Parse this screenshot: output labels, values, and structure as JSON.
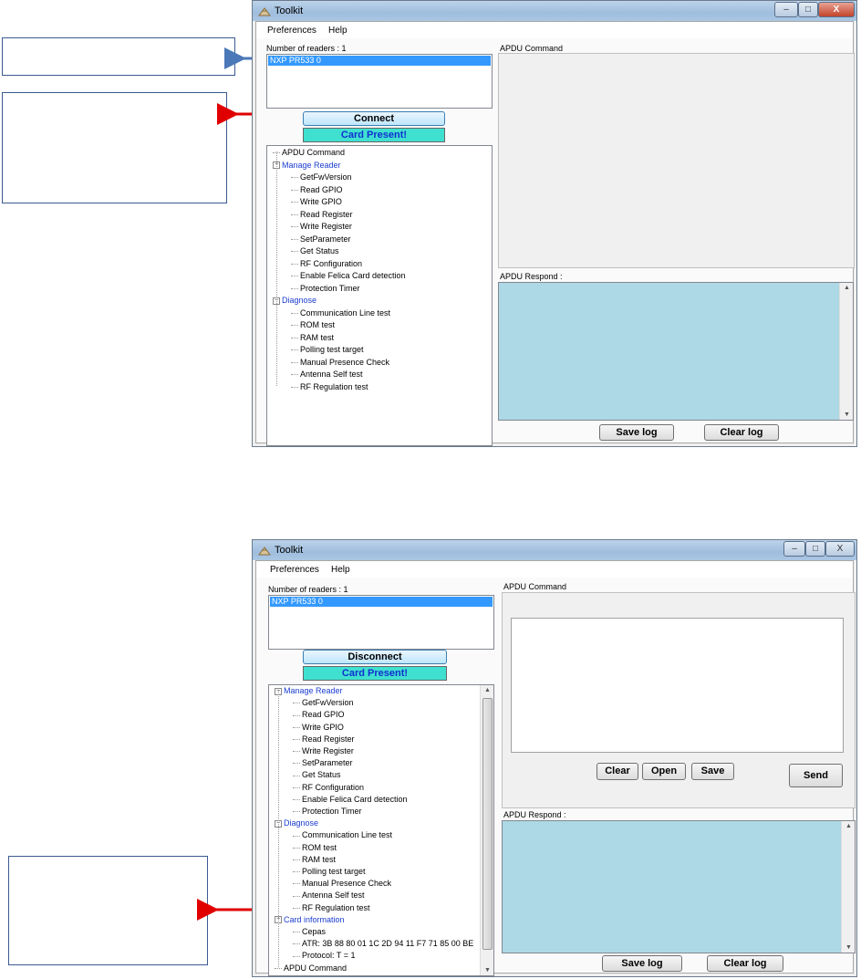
{
  "window_title": "Toolkit",
  "menu": [
    "Preferences",
    "Help"
  ],
  "window_controls": {
    "minimize": "–",
    "maximize": "□",
    "close": "X"
  },
  "readers_label": "Number of readers : 1",
  "reader_item": "NXP PR533 0",
  "apdu_command_label": "APDU Command",
  "apdu_respond_label": "APDU Respond :",
  "save_log": "Save log",
  "clear_log": "Clear log",
  "card_status": "Card Present!",
  "top": {
    "connect_label": "Connect",
    "tree": [
      {
        "label": "APDU Command",
        "level": 0,
        "leaf": true
      },
      {
        "label": "Manage Reader",
        "level": 0,
        "category": true
      },
      {
        "label": "GetFwVersion",
        "level": 1
      },
      {
        "label": "Read GPIO",
        "level": 1
      },
      {
        "label": "Write GPIO",
        "level": 1
      },
      {
        "label": "Read Register",
        "level": 1
      },
      {
        "label": "Write Register",
        "level": 1
      },
      {
        "label": "SetParameter",
        "level": 1
      },
      {
        "label": "Get Status",
        "level": 1
      },
      {
        "label": "RF Configuration",
        "level": 1
      },
      {
        "label": "Enable Felica Card detection",
        "level": 1
      },
      {
        "label": "Protection Timer",
        "level": 1
      },
      {
        "label": "Diagnose",
        "level": 0,
        "category": true
      },
      {
        "label": "Communication Line test",
        "level": 1
      },
      {
        "label": "ROM test",
        "level": 1
      },
      {
        "label": "RAM test",
        "level": 1
      },
      {
        "label": "Polling test target",
        "level": 1
      },
      {
        "label": "Manual Presence Check",
        "level": 1
      },
      {
        "label": "Antenna Self test",
        "level": 1
      },
      {
        "label": "RF Regulation test",
        "level": 1
      }
    ]
  },
  "bottom": {
    "disconnect_label": "Disconnect",
    "clear": "Clear",
    "open": "Open",
    "save": "Save",
    "send": "Send",
    "tree": [
      {
        "label": "Manage Reader",
        "level": 0,
        "category": true
      },
      {
        "label": "GetFwVersion",
        "level": 1
      },
      {
        "label": "Read GPIO",
        "level": 1
      },
      {
        "label": "Write GPIO",
        "level": 1
      },
      {
        "label": "Read Register",
        "level": 1
      },
      {
        "label": "Write Register",
        "level": 1
      },
      {
        "label": "SetParameter",
        "level": 1
      },
      {
        "label": "Get Status",
        "level": 1
      },
      {
        "label": "RF Configuration",
        "level": 1
      },
      {
        "label": "Enable Felica Card detection",
        "level": 1
      },
      {
        "label": "Protection Timer",
        "level": 1
      },
      {
        "label": "Diagnose",
        "level": 0,
        "category": true
      },
      {
        "label": "Communication Line test",
        "level": 1
      },
      {
        "label": "ROM test",
        "level": 1
      },
      {
        "label": "RAM test",
        "level": 1
      },
      {
        "label": "Polling test target",
        "level": 1
      },
      {
        "label": "Manual Presence Check",
        "level": 1
      },
      {
        "label": "Antenna Self test",
        "level": 1
      },
      {
        "label": "RF Regulation test",
        "level": 1
      },
      {
        "label": "Card information",
        "level": 0,
        "category": true,
        "expander": true
      },
      {
        "label": "Cepas",
        "level": 1
      },
      {
        "label": "ATR: 3B 88 80 01 1C 2D 94 11 F7 71 85 00 BE",
        "level": 1
      },
      {
        "label": "Protocol: T = 1",
        "level": 1
      },
      {
        "label": "APDU Command",
        "level": 0,
        "leaf": true
      }
    ]
  },
  "colors": {
    "accent_arrow": "#e00000",
    "blue_arrow": "#4a78b8",
    "respond_bg": "#add8e6",
    "status_bg": "#40e0d0"
  }
}
